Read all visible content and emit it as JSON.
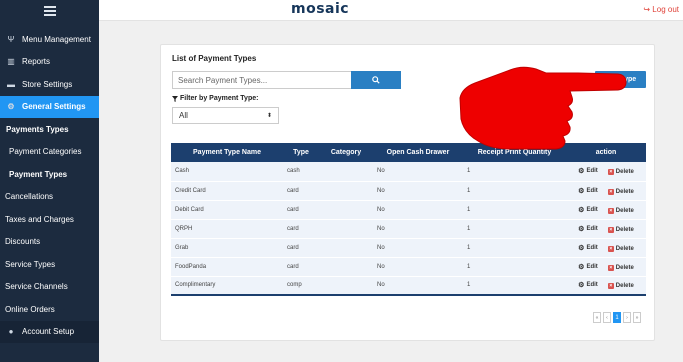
{
  "colors": {
    "sidebar_bg": "#1c2b3f",
    "accent": "#2196f3",
    "button": "#2a7fc3",
    "table_header": "#1c3f6e",
    "logout": "#e0433a",
    "delete": "#d9534f"
  },
  "header": {
    "brand": "mosaic",
    "logout_label": "Log out"
  },
  "sidebar": {
    "items": [
      {
        "label": "Menu Management",
        "icon": "utensils-icon"
      },
      {
        "label": "Reports",
        "icon": "bar-chart-icon"
      },
      {
        "label": "Store Settings",
        "icon": "credit-card-icon"
      },
      {
        "label": "General Settings",
        "icon": "gear-icon"
      }
    ],
    "sub_items": [
      "Payments Types",
      "Payment Categories",
      "Payment Types",
      "Cancellations",
      "Taxes and Charges",
      "Discounts",
      "Service Types",
      "Service Channels",
      "Online Orders"
    ],
    "bottom_item": {
      "label": "Account Setup",
      "icon": "user-icon"
    }
  },
  "main": {
    "title": "List of Payment Types",
    "search_placeholder": "Search Payment Types...",
    "add_button": "Add Type",
    "filter_label": "Filter by Payment Type:",
    "filter_value": "All",
    "table": {
      "headers": [
        "Payment Type Name",
        "Type",
        "Category",
        "Open Cash Drawer",
        "Receipt Print Quantity",
        "action"
      ],
      "rows": [
        {
          "name": "Cash",
          "type": "cash",
          "category": "",
          "drawer": "No",
          "qty": "1"
        },
        {
          "name": "Credit Card",
          "type": "card",
          "category": "",
          "drawer": "No",
          "qty": "1"
        },
        {
          "name": "Debit Card",
          "type": "card",
          "category": "",
          "drawer": "No",
          "qty": "1"
        },
        {
          "name": "QRPH",
          "type": "card",
          "category": "",
          "drawer": "No",
          "qty": "1"
        },
        {
          "name": "Grab",
          "type": "card",
          "category": "",
          "drawer": "No",
          "qty": "1"
        },
        {
          "name": "FoodPanda",
          "type": "card",
          "category": "",
          "drawer": "No",
          "qty": "1"
        },
        {
          "name": "Complimentary",
          "type": "comp",
          "category": "",
          "drawer": "No",
          "qty": "1"
        }
      ],
      "edit_label": "Edit",
      "delete_label": "Delete"
    },
    "pagination": {
      "first": "«",
      "prev": "‹",
      "current": "1",
      "next": "›",
      "last": "»"
    }
  }
}
